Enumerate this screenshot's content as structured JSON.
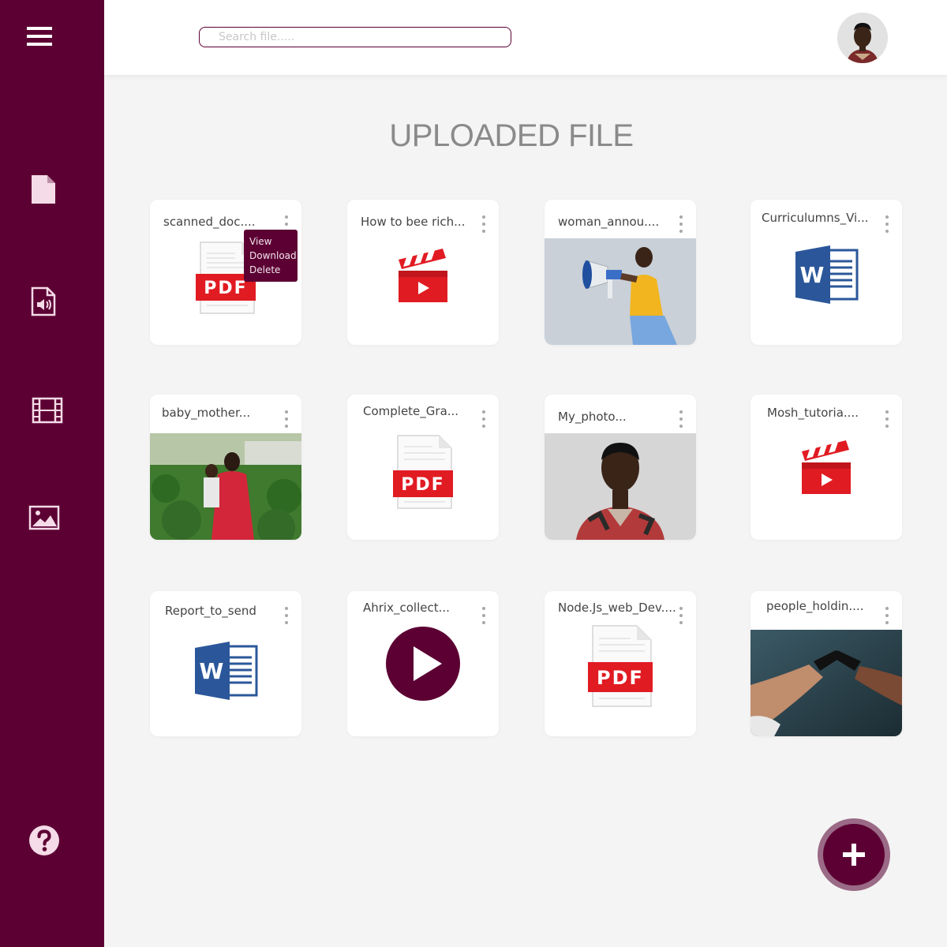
{
  "search": {
    "placeholder": "Search file....."
  },
  "page_title": "UPLOADED FILE",
  "menu": {
    "view": "View",
    "download": "Download",
    "delete": "Delete"
  },
  "colors": {
    "brand": "#5c0033",
    "pdf_red": "#e11b22",
    "word_blue": "#2b579a",
    "background": "#f4f4f4"
  },
  "sidebar": {
    "items": [
      {
        "icon": "menu-icon"
      },
      {
        "icon": "document-icon"
      },
      {
        "icon": "audio-file-icon"
      },
      {
        "icon": "video-film-icon"
      },
      {
        "icon": "image-icon"
      },
      {
        "icon": "help-icon"
      }
    ]
  },
  "files": [
    {
      "name": "scanned_doc....",
      "type": "pdf"
    },
    {
      "name": "How to bee rich...",
      "type": "video"
    },
    {
      "name": "woman_annou....",
      "type": "photo"
    },
    {
      "name": "Curriculumns_Vi...",
      "type": "word"
    },
    {
      "name": "baby_mother...",
      "type": "photo"
    },
    {
      "name": "Complete_Gra...",
      "type": "pdf"
    },
    {
      "name": "My_photo...",
      "type": "photo"
    },
    {
      "name": "Mosh_tutoria....",
      "type": "video"
    },
    {
      "name": "Report_to_send",
      "type": "word"
    },
    {
      "name": "Ahrix_collect...",
      "type": "audio"
    },
    {
      "name": "Node.Js_web_Dev....",
      "type": "pdf"
    },
    {
      "name": "people_holdin....",
      "type": "photo"
    }
  ],
  "fab": {
    "icon": "plus-icon"
  }
}
